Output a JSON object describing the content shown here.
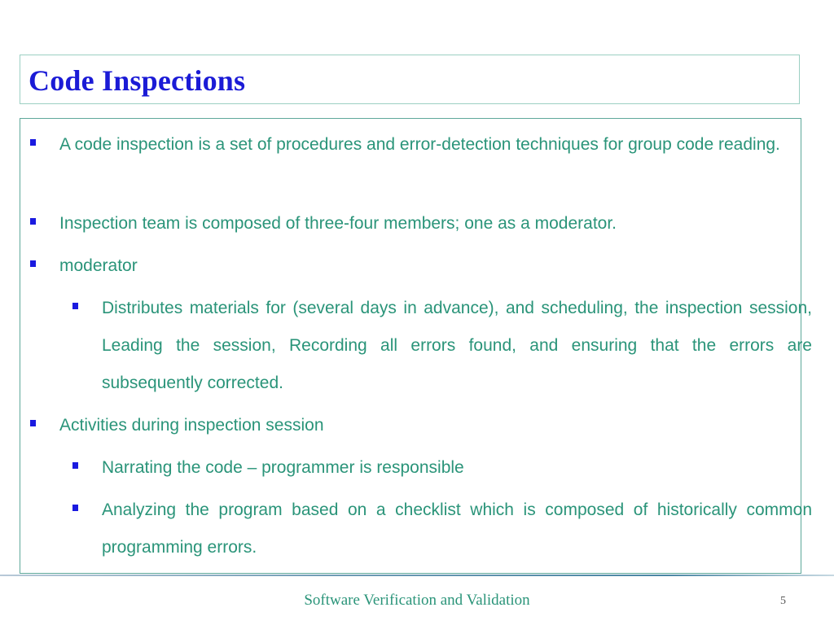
{
  "slide": {
    "title": "Code Inspections",
    "bullets": [
      {
        "level": 1,
        "text": "A code inspection is a set of procedures and error-detection techniques for group code reading."
      },
      {
        "level": 1,
        "text": "Inspection team is composed of three-four members; one as a moderator."
      },
      {
        "level": 1,
        "text": "moderator"
      },
      {
        "level": 2,
        "text": "Distributes materials for (several days in advance), and scheduling, the inspection session, Leading the session,  Recording all errors found, and ensuring that the errors are subsequently corrected."
      },
      {
        "level": 1,
        "text": "Activities during inspection session"
      },
      {
        "level": 2,
        "text": "Narrating the code – programmer is responsible"
      },
      {
        "level": 2,
        "text": "Analyzing the program based on a checklist which is composed of historically common programming errors."
      }
    ],
    "bullet_icon": "square-bullet-icon",
    "colors": {
      "title": "#1b1bd6",
      "body_text": "#2a9479",
      "bullet": "#1a1ae0"
    }
  },
  "footer": {
    "text": "Software Verification and Validation",
    "page_number": "5"
  }
}
